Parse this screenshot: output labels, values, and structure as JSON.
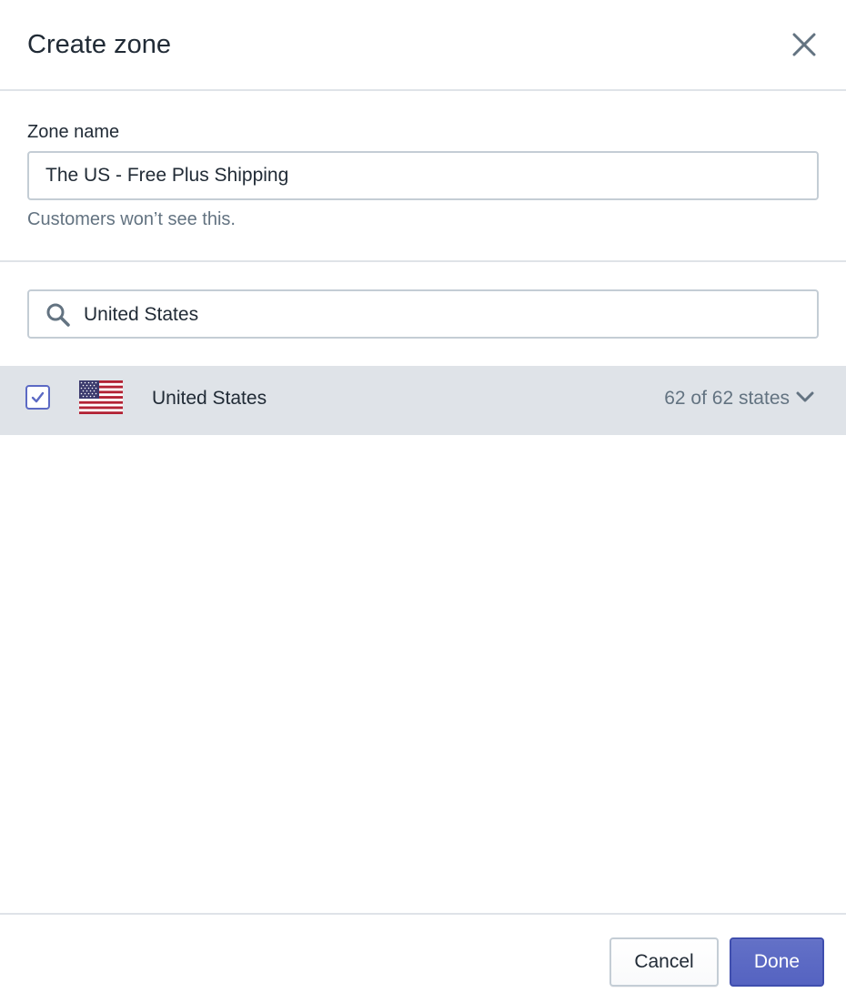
{
  "modal": {
    "title": "Create zone",
    "close_label": "close"
  },
  "zone_name": {
    "label": "Zone name",
    "value": "The US - Free Plus Shipping",
    "help_text": "Customers won’t see this."
  },
  "search": {
    "value": "United States",
    "icon": "search-icon"
  },
  "countries": [
    {
      "name": "United States",
      "checked": true,
      "flag": "us-flag-icon",
      "states_summary": "62 of 62 states",
      "expand_icon": "chevron-down-icon"
    }
  ],
  "footer": {
    "cancel_label": "Cancel",
    "done_label": "Done"
  },
  "colors": {
    "accent": "#5c6ac4",
    "selected_row_bg": "#dfe3e8",
    "border": "#c4cdd5",
    "subdued_text": "#637381"
  }
}
